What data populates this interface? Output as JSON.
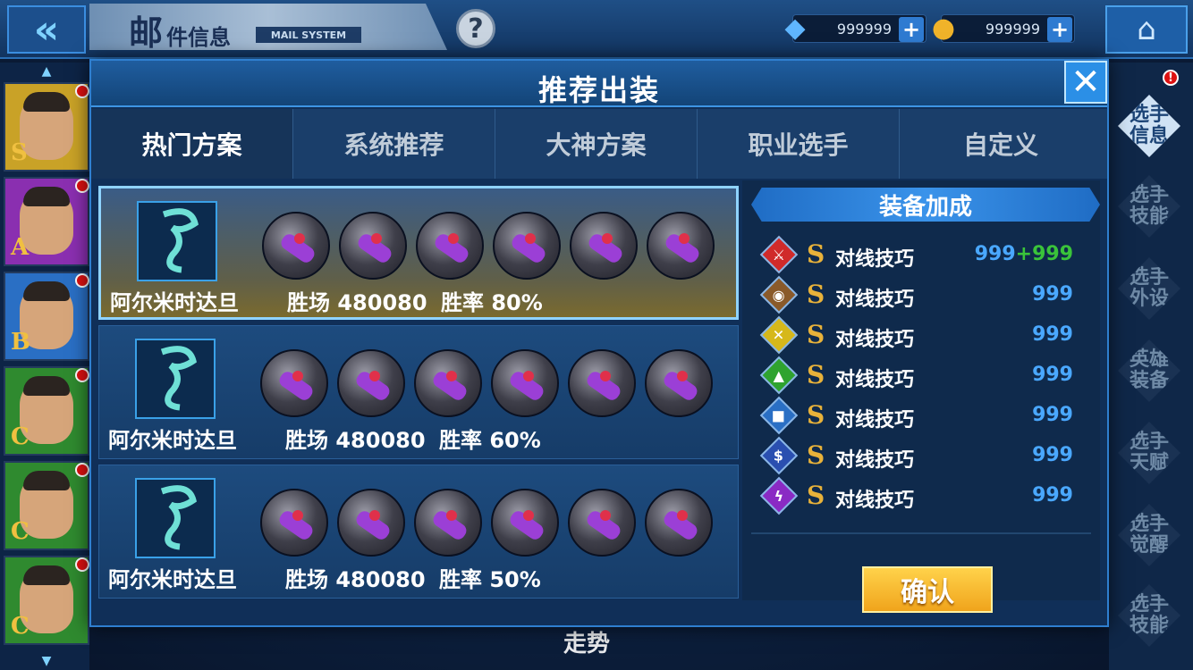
{
  "header": {
    "title_main": "邮",
    "title_sub": "件信息",
    "title_en": "MAIL SYSTEM",
    "help": "?",
    "gems": "999999",
    "gold": "999999",
    "plus": "+"
  },
  "players": [
    {
      "grade": "S"
    },
    {
      "grade": "A"
    },
    {
      "grade": "B"
    },
    {
      "grade": "C"
    },
    {
      "grade": "C"
    },
    {
      "grade": "C"
    }
  ],
  "side_tabs": [
    {
      "label": "选手信息",
      "active": true
    },
    {
      "label": "选手技能"
    },
    {
      "label": "选手外设"
    },
    {
      "label": "英雄装备"
    },
    {
      "label": "选手天赋"
    },
    {
      "label": "选手觉醒"
    },
    {
      "label": "选手技能"
    }
  ],
  "side_badge": "!",
  "modal": {
    "title": "推荐出装",
    "close": "✕",
    "tabs": [
      "热门方案",
      "系统推荐",
      "大神方案",
      "职业选手",
      "自定义"
    ],
    "plans": [
      {
        "hero": "阿尔米时达旦",
        "games": "胜场 480080",
        "rate": "胜率 80%"
      },
      {
        "hero": "阿尔米时达旦",
        "games": "胜场 480080",
        "rate": "胜率 60%"
      },
      {
        "hero": "阿尔米时达旦",
        "games": "胜场 480080",
        "rate": "胜率 50%"
      }
    ],
    "bonus_title": "装备加成",
    "bonus_rows": [
      {
        "icon": "sword-icon",
        "color": "#d02a2a",
        "label": "对线技巧",
        "value": "999",
        "extra": "+999"
      },
      {
        "icon": "eye-icon",
        "color": "#8a5a2a",
        "label": "对线技巧",
        "value": "999"
      },
      {
        "icon": "cross-icon",
        "color": "#d6b81a",
        "label": "对线技巧",
        "value": "999"
      },
      {
        "icon": "boot-icon",
        "color": "#2fa32f",
        "label": "对线技巧",
        "value": "999"
      },
      {
        "icon": "fist-icon",
        "color": "#2a6fc4",
        "label": "对线技巧",
        "value": "999"
      },
      {
        "icon": "dollar-icon",
        "color": "#2a4fb0",
        "label": "对线技巧",
        "value": "999"
      },
      {
        "icon": "bolt-icon",
        "color": "#8a2ac4",
        "label": "对线技巧",
        "value": "999"
      }
    ],
    "s_glyph": "S",
    "confirm": "确认"
  },
  "background_text": "走势"
}
